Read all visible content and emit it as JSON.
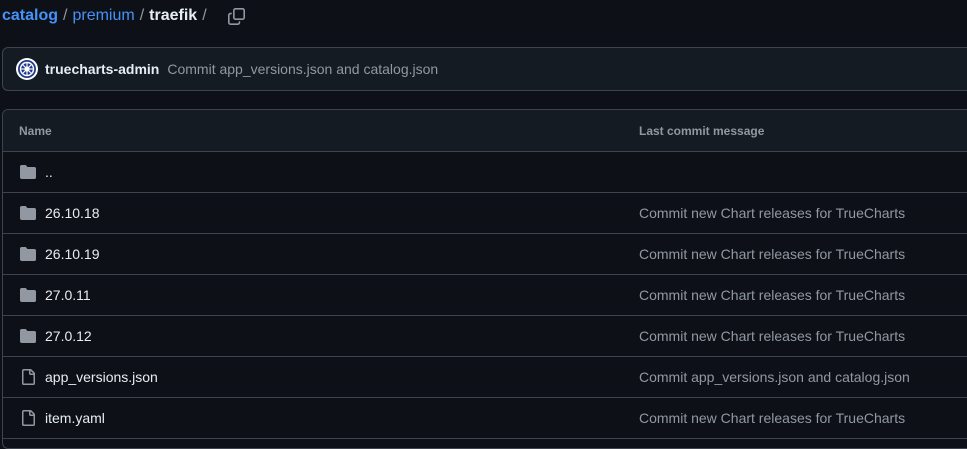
{
  "breadcrumb": {
    "items": [
      "catalog",
      "premium"
    ],
    "separator": "/",
    "current": "traefik",
    "trailing_separator": "/",
    "copy_icon": "copy-icon"
  },
  "latest_commit": {
    "author": "truecharts-admin",
    "message": "Commit app_versions.json and catalog.json"
  },
  "table": {
    "headers": {
      "name": "Name",
      "last_commit_message": "Last commit message"
    },
    "rows": [
      {
        "type": "parent",
        "icon": "folder-icon",
        "name": "..",
        "message": ""
      },
      {
        "type": "folder",
        "icon": "folder-icon",
        "name": "26.10.18",
        "message": "Commit new Chart releases for TrueCharts"
      },
      {
        "type": "folder",
        "icon": "folder-icon",
        "name": "26.10.19",
        "message": "Commit new Chart releases for TrueCharts"
      },
      {
        "type": "folder",
        "icon": "folder-icon",
        "name": "27.0.11",
        "message": "Commit new Chart releases for TrueCharts"
      },
      {
        "type": "folder",
        "icon": "folder-icon",
        "name": "27.0.12",
        "message": "Commit new Chart releases for TrueCharts"
      },
      {
        "type": "file",
        "icon": "file-icon",
        "name": "app_versions.json",
        "message": "Commit app_versions.json and catalog.json"
      },
      {
        "type": "file",
        "icon": "file-icon",
        "name": "item.yaml",
        "message": "Commit new Chart releases for TrueCharts"
      }
    ]
  },
  "colors": {
    "background": "#0d1117",
    "link": "#4493f8",
    "text": "#e6edf3",
    "muted": "#9198a1",
    "border": "#3d444d",
    "header_bg": "#151b23"
  }
}
